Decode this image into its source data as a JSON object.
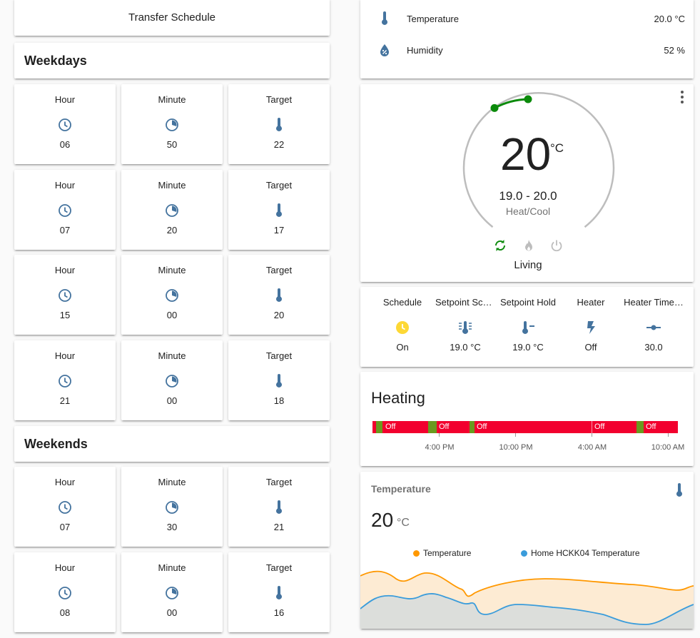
{
  "colors": {
    "icon": "#44739e",
    "green": "#0b8a0b",
    "red": "#f2002e",
    "olive": "#6a9a1f",
    "orange": "#ff9800",
    "blue": "#3a9cdb",
    "sun": "#fdd835"
  },
  "left": {
    "transfer_label": "Transfer Schedule",
    "weekdays_title": "Weekdays",
    "weekends_title": "Weekends",
    "weekdays_rows": [
      [
        {
          "name": "Hour",
          "icon": "clock-icon",
          "value": "06"
        },
        {
          "name": "Minute",
          "icon": "clock-minute-icon",
          "value": "50"
        },
        {
          "name": "Target",
          "icon": "thermometer-icon",
          "value": "22"
        }
      ],
      [
        {
          "name": "Hour",
          "icon": "clock-icon",
          "value": "07"
        },
        {
          "name": "Minute",
          "icon": "clock-minute-icon",
          "value": "20"
        },
        {
          "name": "Target",
          "icon": "thermometer-icon",
          "value": "17"
        }
      ],
      [
        {
          "name": "Hour",
          "icon": "clock-icon",
          "value": "15"
        },
        {
          "name": "Minute",
          "icon": "clock-minute-icon",
          "value": "00"
        },
        {
          "name": "Target",
          "icon": "thermometer-icon",
          "value": "20"
        }
      ],
      [
        {
          "name": "Hour",
          "icon": "clock-icon",
          "value": "21"
        },
        {
          "name": "Minute",
          "icon": "clock-minute-icon",
          "value": "00"
        },
        {
          "name": "Target",
          "icon": "thermometer-icon",
          "value": "18"
        }
      ]
    ],
    "weekends_rows": [
      [
        {
          "name": "Hour",
          "icon": "clock-icon",
          "value": "07"
        },
        {
          "name": "Minute",
          "icon": "clock-minute-icon",
          "value": "30"
        },
        {
          "name": "Target",
          "icon": "thermometer-icon",
          "value": "21"
        }
      ],
      [
        {
          "name": "Hour",
          "icon": "clock-icon",
          "value": "08"
        },
        {
          "name": "Minute",
          "icon": "clock-minute-icon",
          "value": "00"
        },
        {
          "name": "Target",
          "icon": "thermometer-icon",
          "value": "16"
        }
      ]
    ]
  },
  "sensors": [
    {
      "name": "Temperature",
      "icon": "thermometer-icon",
      "value": "20.0 °C"
    },
    {
      "name": "Humidity",
      "icon": "water-percent-icon",
      "value": "52 %"
    }
  ],
  "thermostat": {
    "current": "20",
    "unit": "°C",
    "range": "19.0 - 20.0",
    "mode": "Heat/Cool",
    "name": "Living",
    "modes": [
      "heat-cool-icon",
      "flame-icon",
      "power-icon"
    ]
  },
  "glance": [
    {
      "name": "Schedule",
      "icon": "clock-icon",
      "value": "On"
    },
    {
      "name": "Setpoint Sch…",
      "icon": "thermometer-lines-icon",
      "value": "19.0 °C"
    },
    {
      "name": "Setpoint Hold",
      "icon": "thermometer-minus-icon",
      "value": "19.0 °C"
    },
    {
      "name": "Heater",
      "icon": "flash-icon",
      "value": "Off"
    },
    {
      "name": "Heater Time…",
      "icon": "ray-vertex-icon",
      "value": "30.0"
    }
  ],
  "heating": {
    "title": "Heating",
    "segment_labels": [
      "Off",
      "Off",
      "Off",
      "Off",
      "Off"
    ],
    "ticks": [
      "4:00 PM",
      "10:00 PM",
      "4:00 AM",
      "10:00 AM"
    ]
  },
  "temperature_card": {
    "title": "Temperature",
    "value": "20",
    "unit": "°C",
    "legend": [
      "Temperature",
      "Home HCKK04 Temperature"
    ]
  }
}
